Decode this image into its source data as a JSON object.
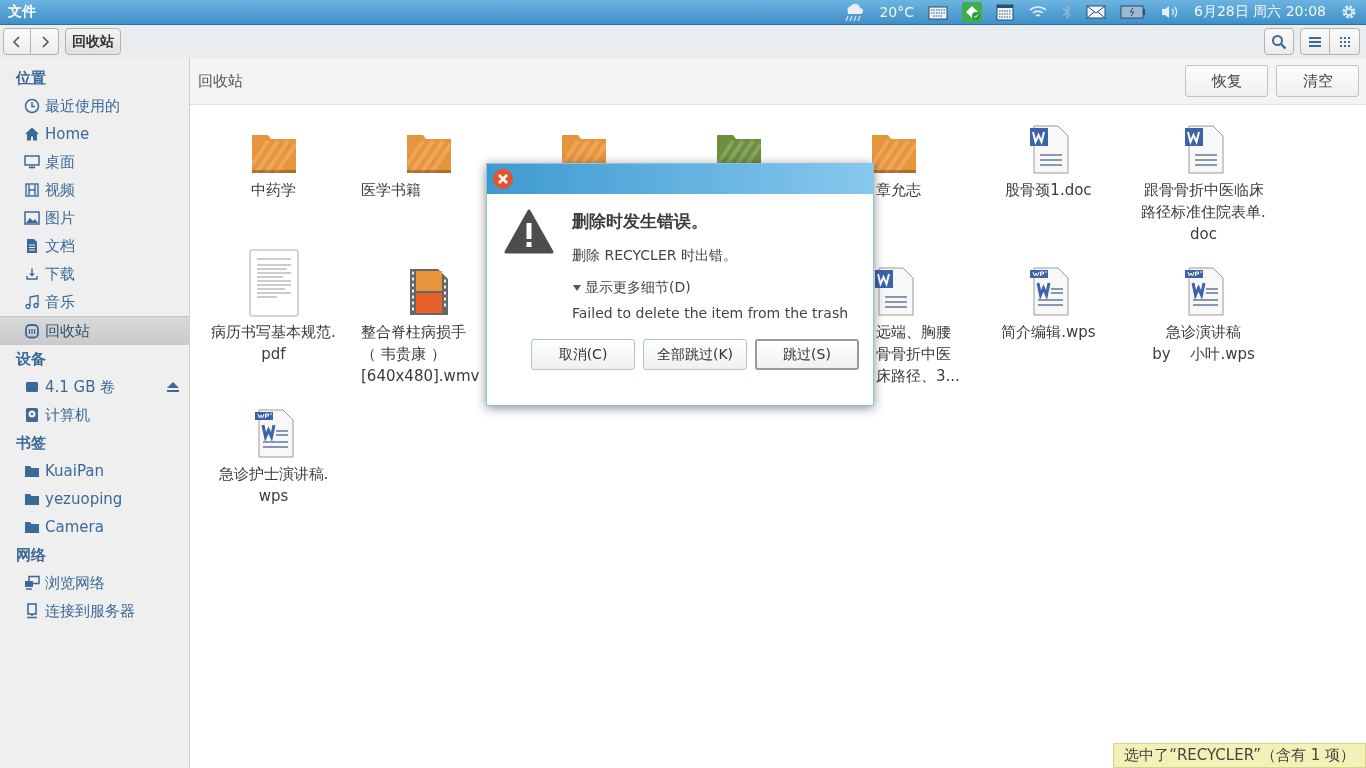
{
  "top_panel": {
    "app_title": "文件",
    "weather": "20°C",
    "clock": "6月28日 周六 20:08"
  },
  "toolbar": {
    "path": [
      {
        "label": "回收站",
        "selected": true
      }
    ]
  },
  "sidebar": {
    "sections": [
      {
        "title": "位置",
        "items": [
          {
            "label": "最近使用的",
            "selected": false
          },
          {
            "label": "Home",
            "selected": false
          },
          {
            "label": "桌面",
            "selected": false
          },
          {
            "label": "视频",
            "selected": false
          },
          {
            "label": "图片",
            "selected": false
          },
          {
            "label": "文档",
            "selected": false
          },
          {
            "label": "下载",
            "selected": false
          },
          {
            "label": "音乐",
            "selected": false
          },
          {
            "label": "回收站",
            "selected": true
          }
        ]
      },
      {
        "title": "设备",
        "items": [
          {
            "label": "4.1 GB 卷",
            "selected": false,
            "eject": true
          },
          {
            "label": "计算机",
            "selected": false,
            "eject": false
          }
        ]
      },
      {
        "title": "书签",
        "items": [
          {
            "label": "KuaiPan",
            "selected": false
          },
          {
            "label": "yezuoping",
            "selected": false
          },
          {
            "label": "Camera",
            "selected": false
          }
        ]
      },
      {
        "title": "网络",
        "items": [
          {
            "label": "浏览网络",
            "selected": false
          },
          {
            "label": "连接到服务器",
            "selected": false
          }
        ]
      }
    ]
  },
  "location": {
    "title": "回收站",
    "buttons": [
      "恢复",
      "清空"
    ]
  },
  "files": [
    {
      "kind": "folder",
      "color": "#e8943a",
      "lines": [
        "中药学"
      ]
    },
    {
      "kind": "folder",
      "color": "#e8943a",
      "lines": [
        "医学书籍"
      ]
    },
    {
      "kind": "folder",
      "color": "#e8943a"
    },
    {
      "kind": "folder",
      "color": "#6f8f3e"
    },
    {
      "kind": "folder",
      "color": "#e8943a",
      "lines": [
        "章允志"
      ]
    },
    {
      "kind": "doc",
      "lines": [
        "股骨颈1.doc"
      ]
    },
    {
      "kind": "doc",
      "lines": [
        "跟骨骨折中医临床",
        "路径标准住院表单.",
        "doc"
      ]
    },
    {
      "kind": "pdf",
      "lines": [
        "病历书写基本规范.",
        "pdf"
      ]
    },
    {
      "kind": "video",
      "lines": [
        "整合脊柱病损手",
        "（ 韦贵康 ）",
        "[640x480].wmv"
      ]
    },
    {
      "kind": "none"
    },
    {
      "kind": "none"
    },
    {
      "kind": "doc",
      "lines": [
        "远端、胸腰",
        "骨骨折中医",
        "床路径、3..."
      ]
    },
    {
      "kind": "wps",
      "lines": [
        "简介编辑.wps"
      ]
    },
    {
      "kind": "wps",
      "lines": [
        "急诊演讲稿",
        "by　 小叶.wps"
      ]
    },
    {
      "kind": "wps",
      "lines": [
        "急诊护士演讲稿.",
        "wps"
      ]
    }
  ],
  "dialog": {
    "heading": "删除时发生错误。",
    "message": "删除 RECYCLER 时出错。",
    "expander": "显示更多细节(D)",
    "detail": "Failed to delete the item from the trash",
    "buttons": [
      {
        "label": "取消(C)",
        "selected": false
      },
      {
        "label": "全部跳过(K)",
        "selected": false
      },
      {
        "label": "跳过(S)",
        "selected": true
      }
    ]
  },
  "status": "选中了“RECYCLER”（含有 1 项）"
}
